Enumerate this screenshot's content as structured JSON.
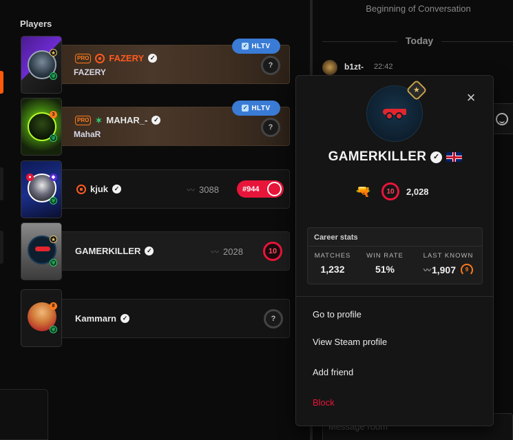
{
  "players_panel": {
    "title": "Players",
    "players": [
      {
        "name": "FAZERY",
        "sub_name": "FAZERY",
        "pro": true,
        "pro_label": "PRO",
        "hltv": true,
        "skill": "?"
      },
      {
        "name": "MAHAR_-",
        "sub_name": "MahaR",
        "pro": true,
        "pro_label": "PRO",
        "hltv": true,
        "skill": "?"
      },
      {
        "name": "kjuk",
        "elo": "3088",
        "rank": "#944"
      },
      {
        "name": "GAMERKILLER",
        "elo": "2028",
        "skill": "10"
      },
      {
        "name": "Kammarn",
        "skill": "?"
      }
    ],
    "hltv_label": "HLTV"
  },
  "chat": {
    "beginning_text": "Beginning of Conversation",
    "today_label": "Today",
    "message_user": "b1zt-",
    "message_time": "22:42",
    "input_placeholder": "Message room"
  },
  "profile_popup": {
    "name": "GAMERKILLER",
    "skill_level": "10",
    "elo": "2,028",
    "career_title": "Career stats",
    "stats": {
      "matches_label": "MATCHES",
      "matches_value": "1,232",
      "winrate_label": "WIN RATE",
      "winrate_value": "51%",
      "last_known_label": "LAST KNOWN",
      "last_known_value": "1,907",
      "last_known_level": "9"
    },
    "menu": {
      "go_to_profile": "Go to profile",
      "view_steam": "View Steam profile",
      "add_friend": "Add friend",
      "block": "Block"
    },
    "icons": {
      "close": "×",
      "country": "united-kingdom-flag"
    }
  },
  "colors": {
    "accent_orange": "#ff5a0a",
    "skill_red": "#e8153a",
    "hltv_blue": "#3a7bd5",
    "block_red": "#e8153a"
  }
}
